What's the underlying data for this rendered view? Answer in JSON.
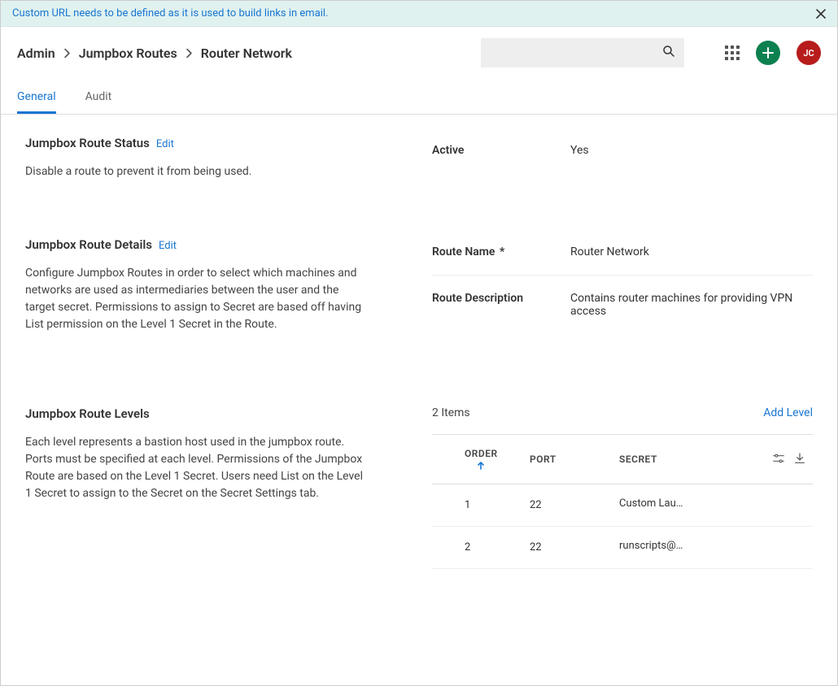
{
  "banner": {
    "text": "Custom URL needs to be defined as it is used to build links in email."
  },
  "breadcrumb": {
    "items": [
      "Admin",
      "Jumpbox Routes",
      "Router Network"
    ]
  },
  "header": {
    "search_placeholder": "",
    "avatar_initials": "JC"
  },
  "tabs": [
    {
      "label": "General",
      "active": true
    },
    {
      "label": "Audit",
      "active": false
    }
  ],
  "sections": {
    "status": {
      "title": "Jumpbox Route Status",
      "edit": "Edit",
      "description": "Disable a route to prevent it from being used.",
      "fields": {
        "active": {
          "label": "Active",
          "value": "Yes"
        }
      }
    },
    "details": {
      "title": "Jumpbox Route Details",
      "edit": "Edit",
      "description": "Configure Jumpbox Routes in order to select which machines and networks are used as intermediaries between the user and the target secret. Permissions to assign to Secret are based off having List permission on the Level 1 Secret in the Route.",
      "fields": {
        "name": {
          "label": "Route Name",
          "required": "*",
          "value": "Router Network"
        },
        "desc": {
          "label": "Route Description",
          "value": "Contains router machines for providing VPN access"
        }
      }
    },
    "levels": {
      "title": "Jumpbox Route Levels",
      "description": "Each level represents a bastion host used in the jumpbox route. Ports must be specified at each level. Permissions of the Jumpbox Route are based on the Level 1 Secret. Users need List on the Level 1 Secret to assign to the Secret on the Secret Settings tab.",
      "count_label": "2 Items",
      "add_label": "Add Level",
      "columns": {
        "order": "ORDER",
        "port": "PORT",
        "secret": "SECRET"
      },
      "rows": [
        {
          "order": "1",
          "port": "22",
          "secret": "Custom Lau…"
        },
        {
          "order": "2",
          "port": "22",
          "secret": "runscripts@…"
        }
      ]
    }
  }
}
